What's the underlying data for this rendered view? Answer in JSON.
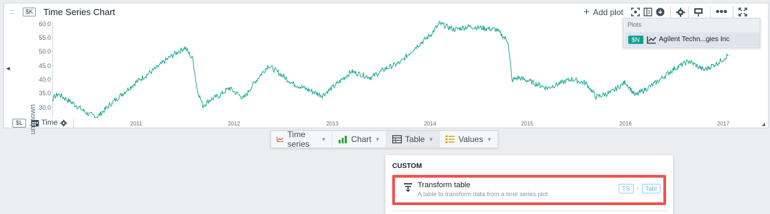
{
  "panel": {
    "grip_icon": "drag-grip-icon",
    "source_badge": "$K",
    "title": "Time Series Chart",
    "add_plot_label": "Add plot",
    "y_axis_label": "unknown",
    "y_ticks": [
      "60.0",
      "55.0",
      "50.0",
      "45.0",
      "40.0",
      "35.0",
      "30.0"
    ],
    "x_ticks": [
      "2011",
      "2012",
      "2013",
      "2014",
      "2015",
      "2016",
      "2017"
    ],
    "time_badge": "$L",
    "time_label": "Time",
    "series_color": "#1aa894"
  },
  "plots_dropdown": {
    "header": "Plots",
    "item_badge": "$N",
    "item_name": "Agilent Techn...gies Inc"
  },
  "toolbar": {
    "time_series": "Time series",
    "chart": "Chart",
    "table": "Table",
    "values": "Values"
  },
  "menu": {
    "section": "CUSTOM",
    "item_title": "Transform table",
    "item_desc": "A table to transform data from a time series plot",
    "tag_from": "TS",
    "tag_to": "Tabl",
    "highlight_color": "#f05350"
  },
  "chart_data": {
    "type": "line",
    "title": "Time Series Chart",
    "xlabel": "Time",
    "ylabel": "unknown",
    "ylim": [
      28.5,
      61
    ],
    "x": [
      2010.0,
      2010.2,
      2010.35,
      2010.5,
      2010.6,
      2010.75,
      2011.0,
      2011.2,
      2011.35,
      2011.5,
      2011.58,
      2011.62,
      2011.68,
      2011.75,
      2011.85,
      2011.95,
      2012.1,
      2012.2,
      2012.35,
      2012.5,
      2012.6,
      2012.75,
      2012.9,
      2013.0,
      2013.2,
      2013.4,
      2013.55,
      2013.7,
      2013.85,
      2014.0,
      2014.1,
      2014.25,
      2014.4,
      2014.55,
      2014.68,
      2014.8,
      2014.84,
      2014.9,
      2015.0,
      2015.2,
      2015.45,
      2015.6,
      2015.7,
      2015.85,
      2016.0,
      2016.1,
      2016.3,
      2016.5,
      2016.65,
      2016.8,
      2016.95,
      2017.05
    ],
    "values": [
      30.5,
      36.5,
      33.5,
      30.0,
      28.8,
      33.5,
      40.5,
      45.0,
      49.0,
      52.0,
      48.0,
      38.5,
      32.5,
      34.5,
      36.0,
      38.5,
      35.0,
      40.0,
      46.0,
      42.5,
      40.0,
      38.0,
      36.0,
      38.5,
      44.0,
      42.0,
      45.0,
      47.0,
      52.0,
      56.0,
      60.0,
      58.0,
      59.0,
      58.5,
      58.0,
      54.0,
      41.0,
      42.0,
      41.0,
      38.5,
      41.5,
      40.0,
      35.5,
      37.0,
      40.5,
      36.0,
      40.0,
      45.0,
      47.5,
      44.5,
      47.0,
      49.5
    ]
  }
}
